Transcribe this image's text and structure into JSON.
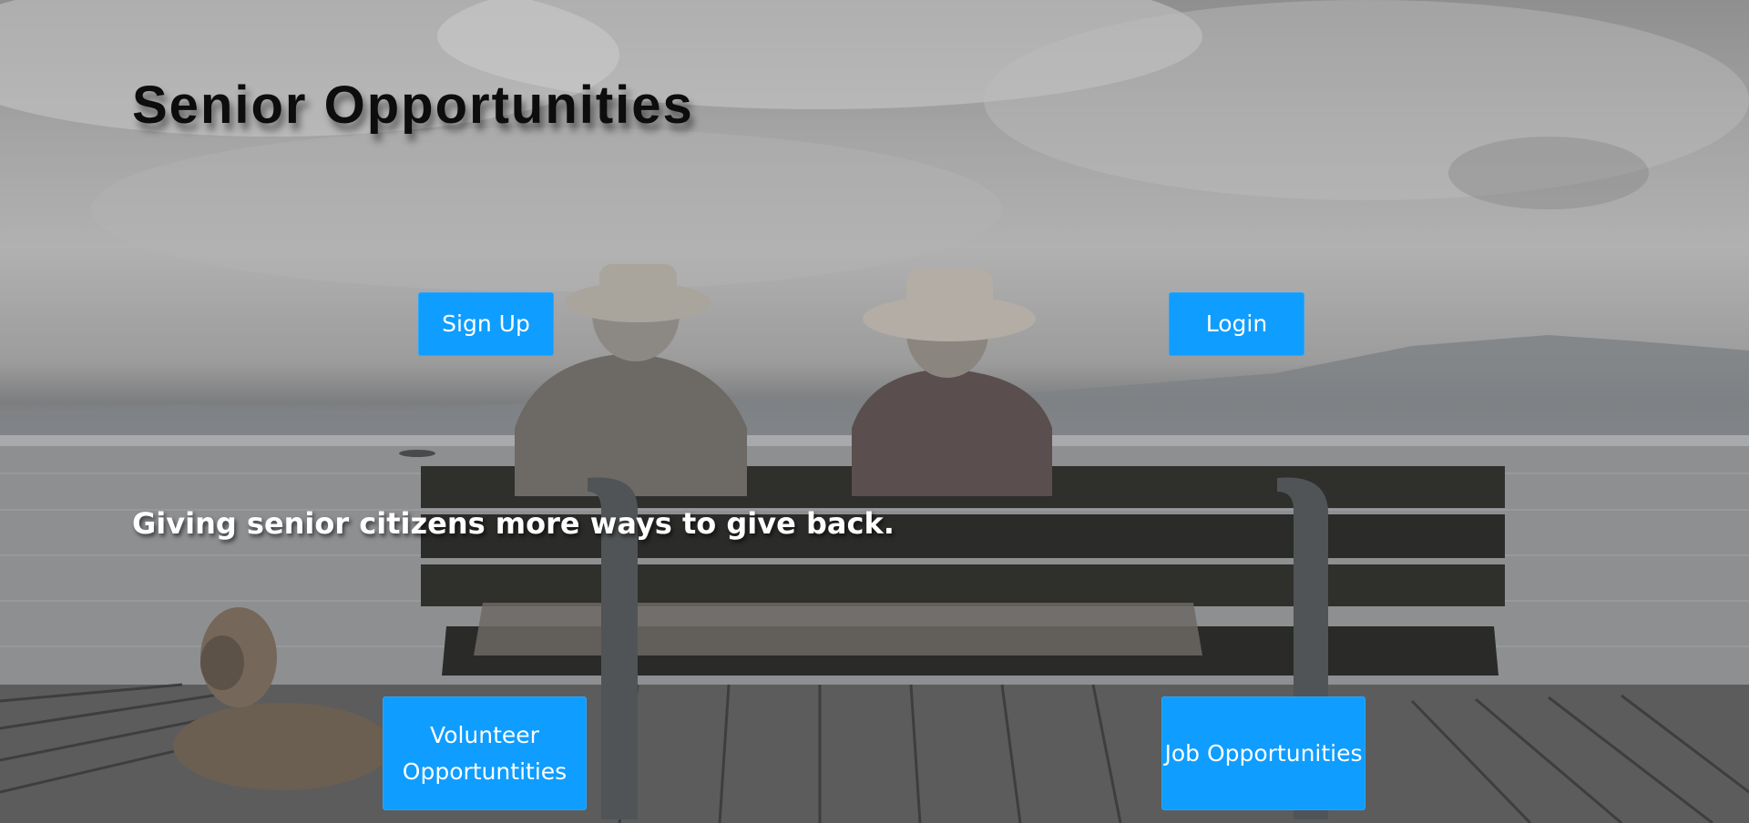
{
  "site": {
    "title": "Senior Opportunities",
    "tagline": "Giving senior citizens more ways to give back."
  },
  "buttons": {
    "sign_up": "Sign Up",
    "login": "Login",
    "volunteer": "Volunteer Opportuntities",
    "job": "Job Opportunities"
  },
  "colors": {
    "button_background": "#0f9dff",
    "button_text": "#ffffff",
    "title_text": "#0d0d0d",
    "tagline_text": "#ffffff"
  },
  "background": {
    "type": "photo",
    "description_icon": "bench-scene-image"
  }
}
